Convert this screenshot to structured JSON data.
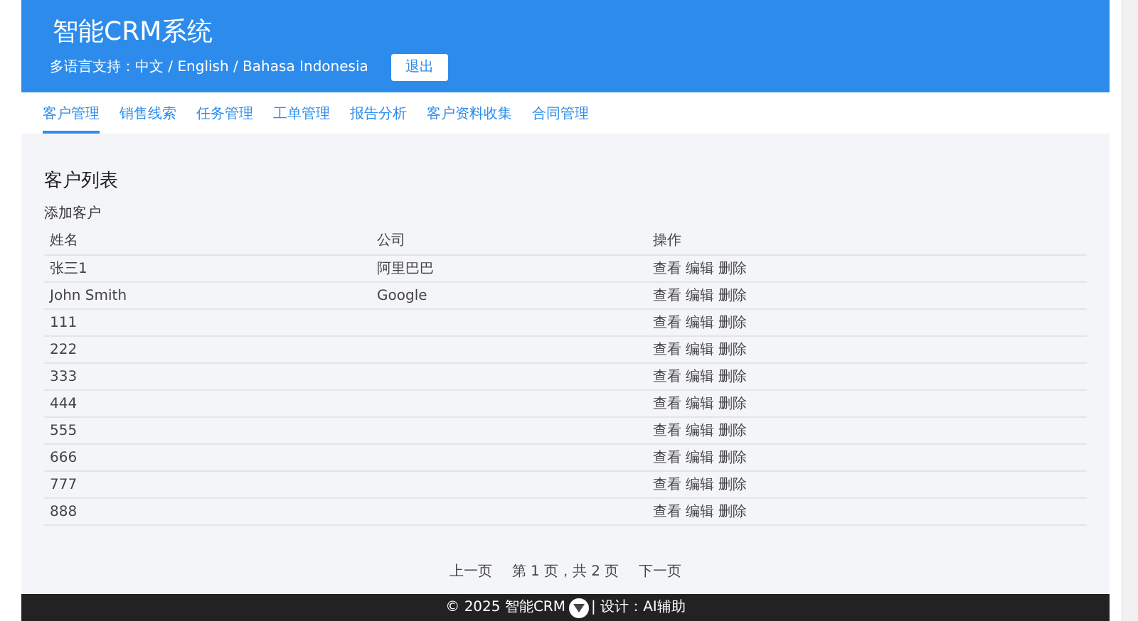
{
  "header": {
    "title": "智能CRM系统",
    "languages": "多语言支持：中文 / English / Bahasa Indonesia",
    "logout": "退出"
  },
  "tabs": [
    {
      "label": "客户管理",
      "selected": true
    },
    {
      "label": "销售线索",
      "selected": false
    },
    {
      "label": "任务管理",
      "selected": false
    },
    {
      "label": "工单管理",
      "selected": false
    },
    {
      "label": "报告分析",
      "selected": false
    },
    {
      "label": "客户资料收集",
      "selected": false
    },
    {
      "label": "合同管理",
      "selected": false
    }
  ],
  "section": {
    "title": "客户列表",
    "add_link": "添加客户"
  },
  "table": {
    "columns": [
      "姓名",
      "公司",
      "操作"
    ],
    "rows": [
      {
        "name": "张三1",
        "company": "阿里巴巴",
        "actions": [
          "查看",
          "编辑",
          "删除"
        ]
      },
      {
        "name": "John Smith",
        "company": "Google",
        "actions": [
          "查看",
          "编辑",
          "删除"
        ]
      },
      {
        "name": "111",
        "company": "",
        "actions": [
          "查看",
          "编辑",
          "删除"
        ]
      },
      {
        "name": "222",
        "company": "",
        "actions": [
          "查看",
          "编辑",
          "删除"
        ]
      },
      {
        "name": "333",
        "company": "",
        "actions": [
          "查看",
          "编辑",
          "删除"
        ]
      },
      {
        "name": "444",
        "company": "",
        "actions": [
          "查看",
          "编辑",
          "删除"
        ]
      },
      {
        "name": "555",
        "company": "",
        "actions": [
          "查看",
          "编辑",
          "删除"
        ]
      },
      {
        "name": "666",
        "company": "",
        "actions": [
          "查看",
          "编辑",
          "删除"
        ]
      },
      {
        "name": "777",
        "company": "",
        "actions": [
          "查看",
          "编辑",
          "删除"
        ]
      },
      {
        "name": "888",
        "company": "",
        "actions": [
          "查看",
          "编辑",
          "删除"
        ]
      }
    ]
  },
  "pagination": {
    "previous": "上一页",
    "info": "第 1 页，共 2 页",
    "next": "下一页"
  },
  "footer": {
    "left": "© 2025 智能CRM",
    "right": "| 设计：AI辅助"
  }
}
